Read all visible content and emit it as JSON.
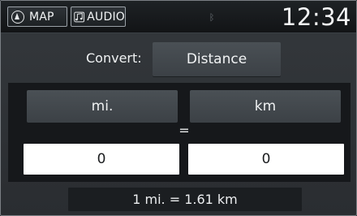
{
  "topbar": {
    "map_label": "MAP",
    "audio_label": "AUDIO",
    "clock": "12:34",
    "icons": {
      "map": "navigation-arrow-icon",
      "audio": "music-note-icon",
      "status": "bluetooth-icon"
    }
  },
  "convert": {
    "label": "Convert:",
    "value": "Distance"
  },
  "units": {
    "from": "mi.",
    "to": "km",
    "equals": "="
  },
  "values": {
    "from": "0",
    "to": "0"
  },
  "footer": {
    "ratio": "1 mi. = 1.61 km"
  }
}
